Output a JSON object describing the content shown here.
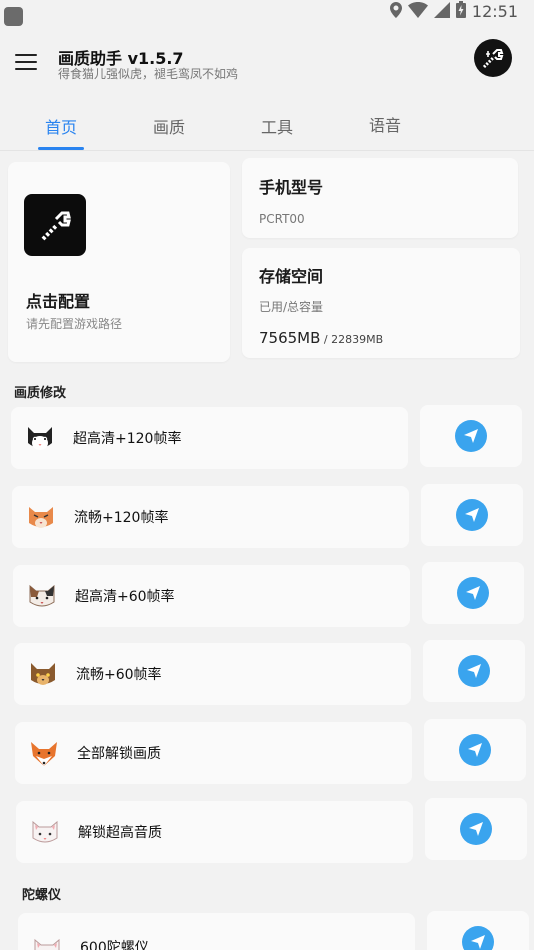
{
  "status_bar": {
    "time": "12:51"
  },
  "header": {
    "title": "画质助手 v1.5.7",
    "subtitle": "得食猫儿强似虎，褪毛鸾凤不如鸡"
  },
  "tabs": [
    {
      "label": "首页",
      "active": true
    },
    {
      "label": "画质",
      "active": false
    },
    {
      "label": "工具",
      "active": false
    },
    {
      "label": "语音",
      "active": false
    }
  ],
  "config_card": {
    "title": "点击配置",
    "subtitle": "请先配置游戏路径"
  },
  "model_card": {
    "title": "手机型号",
    "value": "PCRT00"
  },
  "storage_card": {
    "title": "存储空间",
    "label": "已用/总容量",
    "used": "7565MB",
    "total": " / 22839MB"
  },
  "sections": {
    "quality": "画质修改",
    "gyro": "陀螺仪"
  },
  "quality_items": [
    {
      "label": "超高清+120帧率",
      "avatar": "black-white-cat-icon"
    },
    {
      "label": "流畅+120帧率",
      "avatar": "orange-cat-icon"
    },
    {
      "label": "超高清+60帧率",
      "avatar": "calico-cat-icon"
    },
    {
      "label": "流畅+60帧率",
      "avatar": "brown-cat-icon"
    },
    {
      "label": "全部解锁画质",
      "avatar": "fox-icon"
    },
    {
      "label": "解锁超高音质",
      "avatar": "white-cat-icon"
    }
  ],
  "gyro_items": [
    {
      "label": "600陀螺仪",
      "avatar": "white-cat-icon"
    }
  ],
  "colors": {
    "accent": "#2a84f0",
    "send_button": "#3aa4ee",
    "background": "#f2f2f2",
    "card": "#fafafa"
  }
}
